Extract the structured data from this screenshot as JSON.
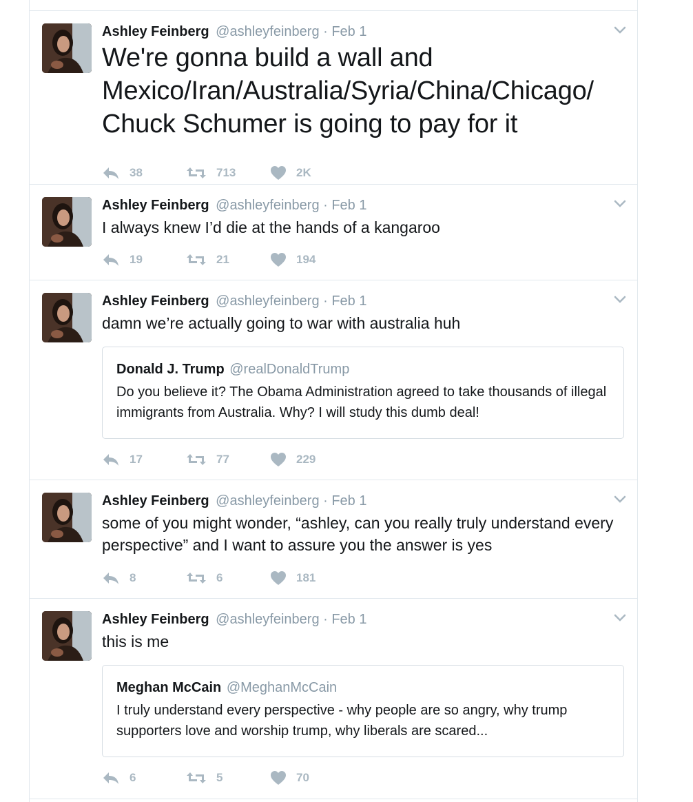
{
  "tweets": [
    {
      "name": "Ashley Feinberg",
      "handle": "@ashleyfeinberg",
      "date": "Feb 1",
      "text": "We're gonna build a wall and Mexico/Iran/Australia/Syria/China/Chicago/ Chuck Schumer is going to pay for it",
      "replies": "38",
      "retweets": "713",
      "likes": "2K"
    },
    {
      "name": "Ashley Feinberg",
      "handle": "@ashleyfeinberg",
      "date": "Feb 1",
      "text": "I always knew I’d die at the hands of a kangaroo",
      "replies": "19",
      "retweets": "21",
      "likes": "194"
    },
    {
      "name": "Ashley Feinberg",
      "handle": "@ashleyfeinberg",
      "date": "Feb 1",
      "text": "damn we’re actually going to war with australia huh",
      "quote": {
        "name": "Donald J. Trump",
        "handle": "@realDonaldTrump",
        "text": "Do you believe it? The Obama Administration agreed to take thousands of illegal immigrants from Australia. Why? I will study this dumb deal!"
      },
      "replies": "17",
      "retweets": "77",
      "likes": "229"
    },
    {
      "name": "Ashley Feinberg",
      "handle": "@ashleyfeinberg",
      "date": "Feb 1",
      "text": "some of you might wonder, “ashley, can you really truly understand every perspective” and I want to assure you the answer is yes",
      "replies": "8",
      "retweets": "6",
      "likes": "181"
    },
    {
      "name": "Ashley Feinberg",
      "handle": "@ashleyfeinberg",
      "date": "Feb 1",
      "text": "this is me",
      "quote": {
        "name": "Meghan McCain",
        "handle": "@MeghanMcCain",
        "text": "I truly understand every perspective - why people are so angry, why trump supporters love and worship trump, why liberals are scared..."
      },
      "replies": "6",
      "retweets": "5",
      "likes": "70"
    }
  ],
  "icons": {
    "reply": "reply-icon",
    "retweet": "retweet-icon",
    "like": "heart-icon",
    "caret": "chevron-down-icon"
  },
  "colors": {
    "text": "#14171a",
    "meta": "#8899a6",
    "action": "#aab8c2",
    "border": "#e1e8ed"
  }
}
